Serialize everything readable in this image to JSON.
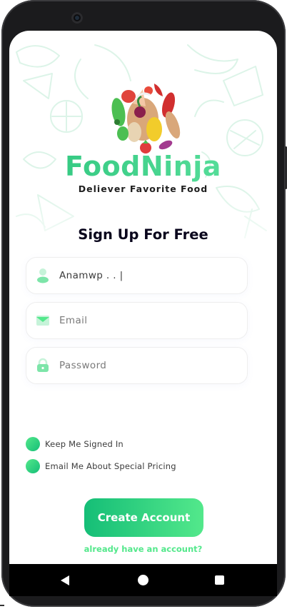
{
  "app": {
    "brand_name": "FoodNinja",
    "tagline": "Deliever Favorite Food",
    "brand_color": "#53E88B",
    "brand_color_dark": "#15BE77"
  },
  "signup": {
    "title": "Sign Up For Free",
    "fields": [
      {
        "id": "username",
        "icon": "profile-icon",
        "value": "Anamwp . . |",
        "placeholder": ""
      },
      {
        "id": "email",
        "icon": "mail-icon",
        "value": "",
        "placeholder": "Email"
      },
      {
        "id": "password",
        "icon": "lock-icon",
        "value": "",
        "placeholder": "Password"
      }
    ],
    "options": [
      {
        "label": "Keep Me Signed In",
        "checked": true
      },
      {
        "label": "Email Me About Special Pricing",
        "checked": true
      }
    ],
    "create_button": "Create Account",
    "login_link": "already have an account?"
  },
  "system_nav": {
    "back_icon": "triangle-back-icon",
    "home_icon": "circle-home-icon",
    "recent_icon": "square-recents-icon"
  }
}
